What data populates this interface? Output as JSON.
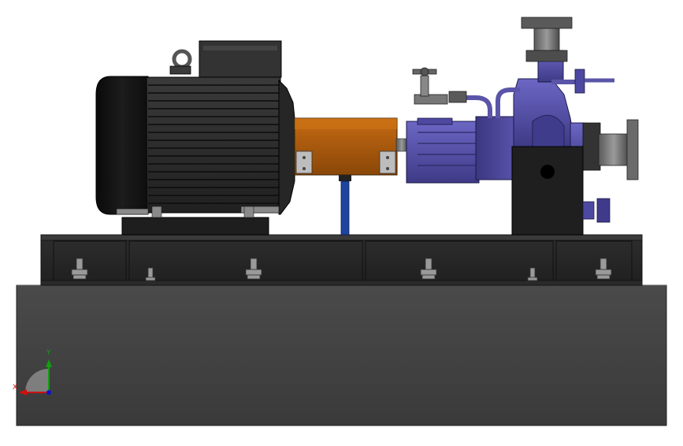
{
  "viewport": {
    "background": "#ffffff"
  },
  "triad": {
    "x_label": "X",
    "y_label": "Y",
    "x_color": "#d01010",
    "y_color": "#10a010",
    "z_color": "#1010d0"
  },
  "colors": {
    "skid": "#3f3f3f",
    "motor": "#2b2b2b",
    "coupling_guard": "#b8600f",
    "pump": "#5a55a8",
    "support_leg": "#1e44a0"
  }
}
